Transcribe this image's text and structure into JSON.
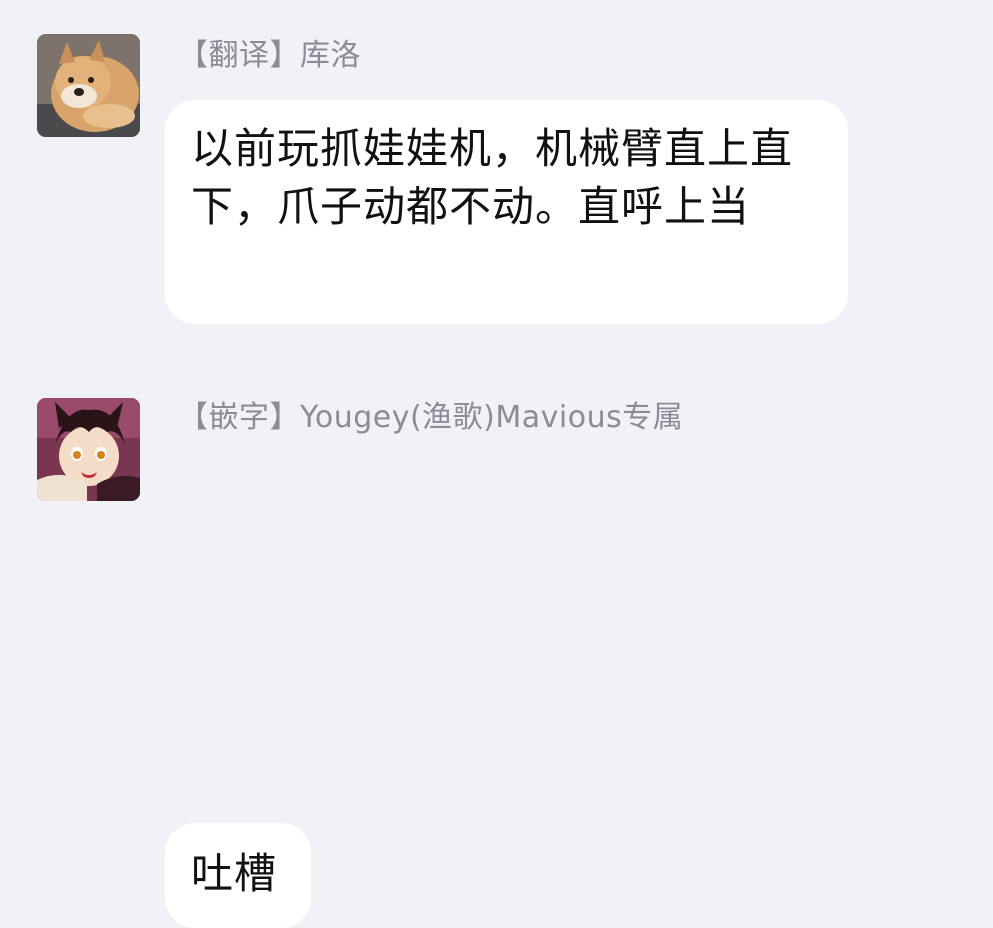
{
  "messages": [
    {
      "avatar_icon": "shiba-dog-avatar-icon",
      "sender": "【翻译】库洛",
      "text": "以前玩抓娃娃机，机械臂直上直下，爪子动都不动。直呼上当"
    },
    {
      "avatar_icon": "anime-boy-avatar-icon",
      "sender": "【嵌字】Yougey(渔歌)Mavious专属",
      "text": "吐槽"
    }
  ],
  "colors": {
    "background": "#f1f2f7",
    "bubble": "#ffffff",
    "sender_text": "#8a8c96",
    "message_text": "#111111"
  }
}
